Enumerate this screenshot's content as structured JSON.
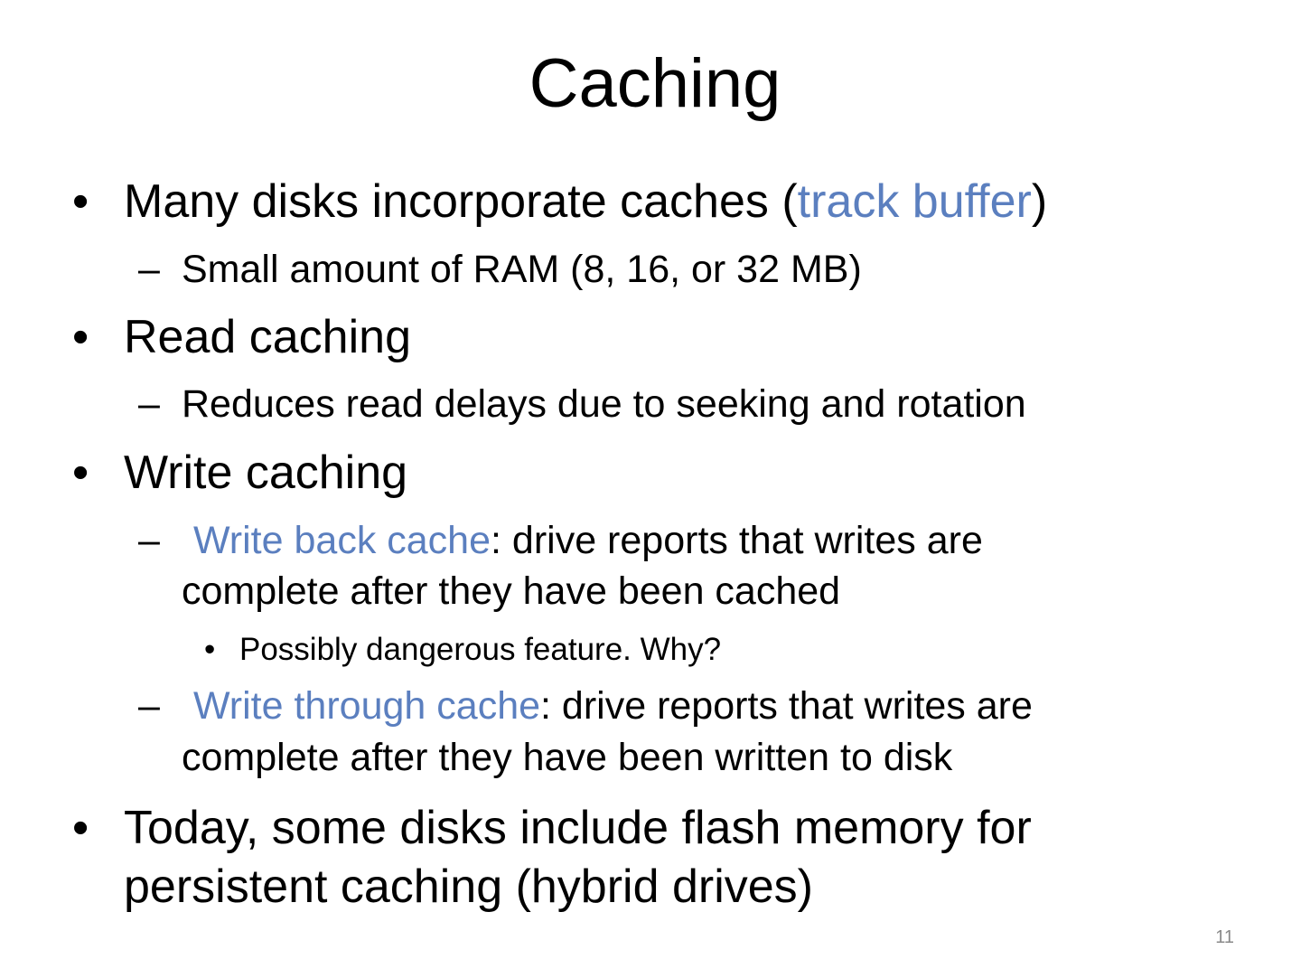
{
  "slide": {
    "title": "Caching",
    "accent_color": "#5b7fbf",
    "bullet_glyph": "•",
    "dash_glyph": "–",
    "items": [
      {
        "text_before": "Many disks incorporate caches (",
        "highlight": "track buffer",
        "text_after": ")",
        "sub": "Small amount of RAM (8, 16, or 32 MB)"
      },
      {
        "text": "Read caching",
        "sub": "Reduces read delays due to seeking and rotation"
      },
      {
        "text": "Write caching",
        "subs": [
          {
            "highlight": "Write back cache",
            "line1_rest": ": drive reports that writes are",
            "line2": "complete after they have been cached",
            "sub": "Possibly dangerous feature. Why?"
          },
          {
            "highlight": "Write through cache",
            "line1_rest": ": drive reports that writes are",
            "line2": "complete after they have been written to disk"
          }
        ]
      },
      {
        "line1": "Today, some disks include flash memory for",
        "line2": "persistent caching (hybrid drives)"
      }
    ],
    "page_number": "11"
  }
}
